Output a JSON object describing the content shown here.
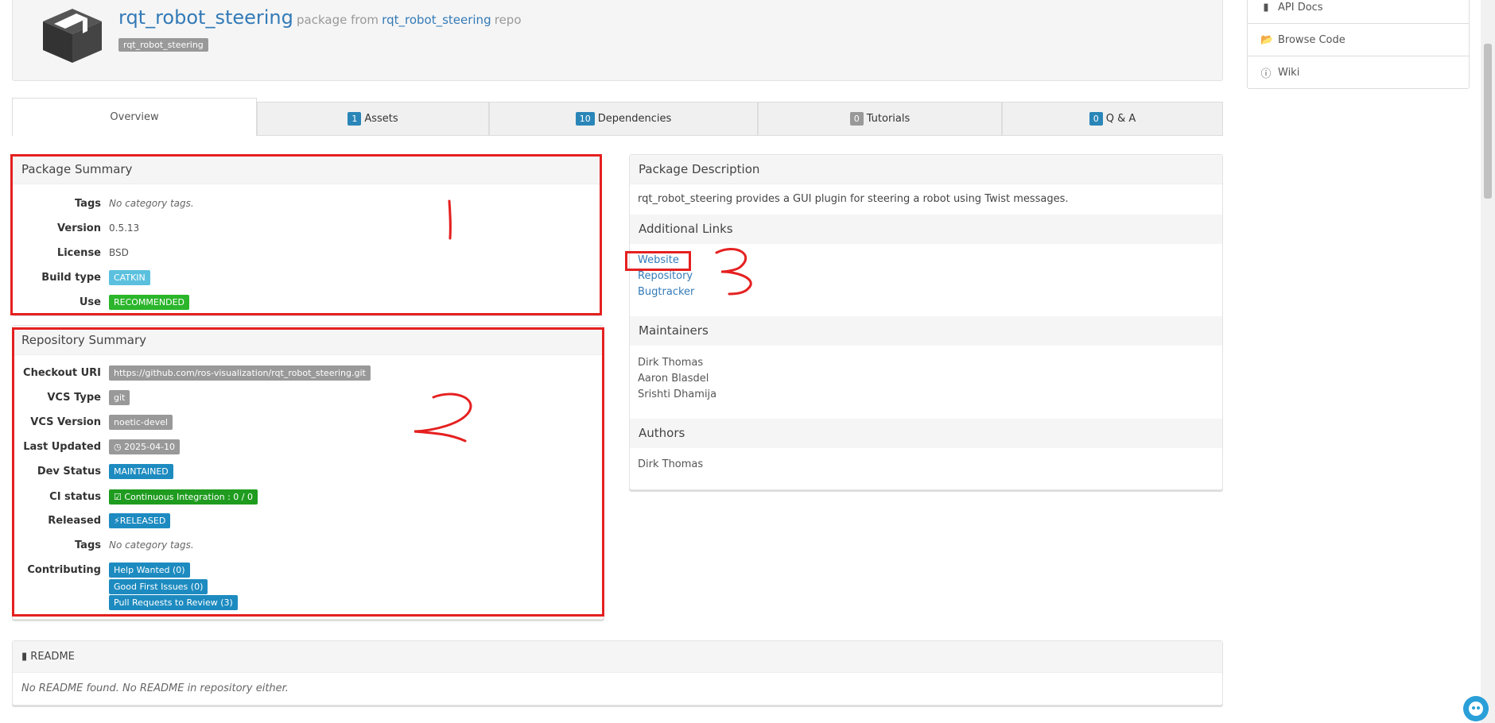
{
  "header": {
    "package_name": "rqt_robot_steering",
    "package_from": "package from",
    "repo_name": "rqt_robot_steering",
    "repo_word": "repo",
    "tag": "rqt_robot_steering"
  },
  "side_menu": {
    "items": [
      {
        "label": "API Docs",
        "icon": "file-icon"
      },
      {
        "label": "Browse Code",
        "icon": "folder-open-icon"
      },
      {
        "label": "Wiki",
        "icon": "info-icon"
      }
    ]
  },
  "tabs": [
    {
      "label": "Overview",
      "count": null
    },
    {
      "label": "Assets",
      "count": "1"
    },
    {
      "label": "Dependencies",
      "count": "10"
    },
    {
      "label": "Tutorials",
      "count": "0"
    },
    {
      "label": "Q & A",
      "count": "0"
    }
  ],
  "package_summary": {
    "title": "Package Summary",
    "tags_label": "Tags",
    "tags_value": "No category tags.",
    "version_label": "Version",
    "version_value": "0.5.13",
    "license_label": "License",
    "license_value": "BSD",
    "build_label": "Build type",
    "build_value": "CATKIN",
    "use_label": "Use",
    "use_value": "RECOMMENDED"
  },
  "repo_summary": {
    "title": "Repository Summary",
    "checkout_label": "Checkout URI",
    "checkout_value": "https://github.com/ros-visualization/rqt_robot_steering.git",
    "vcs_type_label": "VCS Type",
    "vcs_type_value": "git",
    "vcs_version_label": "VCS Version",
    "vcs_version_value": "noetic-devel",
    "updated_label": "Last Updated",
    "updated_value": "2025-04-10",
    "dev_status_label": "Dev Status",
    "dev_status_value": "MAINTAINED",
    "ci_label": "CI status",
    "ci_value": "Continuous Integration : 0 / 0",
    "released_label": "Released",
    "released_value": "RELEASED",
    "tags_label": "Tags",
    "tags_value": "No category tags.",
    "contributing_label": "Contributing",
    "help_wanted": "Help Wanted (0)",
    "good_first": "Good First Issues (0)",
    "pull_requests": "Pull Requests to Review (3)"
  },
  "description": {
    "title": "Package Description",
    "text": "rqt_robot_steering provides a GUI plugin for steering a robot using Twist messages.",
    "links_title": "Additional Links",
    "links": [
      "Website",
      "Repository",
      "Bugtracker"
    ],
    "maintainers_title": "Maintainers",
    "maintainers": [
      "Dirk Thomas",
      "Aaron Blasdel",
      "Srishti Dhamija"
    ],
    "authors_title": "Authors",
    "authors": [
      "Dirk Thomas"
    ]
  },
  "readme": {
    "title": "README",
    "text": "No README found. No README in repository either."
  },
  "annotations": {
    "color": "#e52020"
  }
}
